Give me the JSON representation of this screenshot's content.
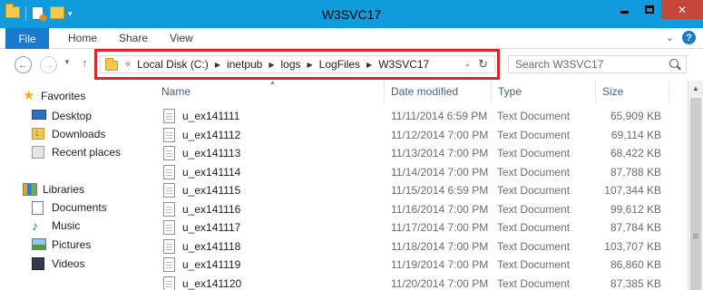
{
  "window": {
    "title": "W3SVC17",
    "accent": "#0f9bdc",
    "close_color": "#c7463a",
    "close_glyph": "✕",
    "qat_dropdown": "▾"
  },
  "ribbon": {
    "tabs": [
      {
        "label": "File"
      },
      {
        "label": "Home"
      },
      {
        "label": "Share"
      },
      {
        "label": "View"
      }
    ],
    "collapse_glyph": "⌄",
    "help_glyph": "?"
  },
  "navigation": {
    "back_glyph": "←",
    "forward_glyph": "→",
    "recent_glyph": "▼",
    "up_glyph": "↑",
    "address_prefix": "«",
    "breadcrumbs": [
      "Local Disk (C:)",
      "inetpub",
      "logs",
      "LogFiles",
      "W3SVC17"
    ],
    "crumb_separator": "▶",
    "dropdown_glyph": "⌄",
    "refresh_glyph": "↻",
    "highlight_color": "#d8262e"
  },
  "search": {
    "placeholder": "Search W3SVC17"
  },
  "nav_pane": {
    "favorites": {
      "label": "Favorites",
      "items": [
        "Desktop",
        "Downloads",
        "Recent places"
      ]
    },
    "libraries": {
      "label": "Libraries",
      "items": [
        "Documents",
        "Music",
        "Pictures",
        "Videos"
      ]
    }
  },
  "file_list": {
    "sort_glyph": "▲",
    "columns": [
      "Name",
      "Date modified",
      "Type",
      "Size"
    ],
    "rows": [
      {
        "name": "u_ex141111",
        "date": "11/11/2014 6:59 PM",
        "type": "Text Document",
        "size": "65,909 KB"
      },
      {
        "name": "u_ex141112",
        "date": "11/12/2014 7:00 PM",
        "type": "Text Document",
        "size": "69,114 KB"
      },
      {
        "name": "u_ex141113",
        "date": "11/13/2014 7:00 PM",
        "type": "Text Document",
        "size": "68,422 KB"
      },
      {
        "name": "u_ex141114",
        "date": "11/14/2014 7:00 PM",
        "type": "Text Document",
        "size": "87,788 KB"
      },
      {
        "name": "u_ex141115",
        "date": "11/15/2014 6:59 PM",
        "type": "Text Document",
        "size": "107,344 KB"
      },
      {
        "name": "u_ex141116",
        "date": "11/16/2014 7:00 PM",
        "type": "Text Document",
        "size": "99,612 KB"
      },
      {
        "name": "u_ex141117",
        "date": "11/17/2014 7:00 PM",
        "type": "Text Document",
        "size": "87,784 KB"
      },
      {
        "name": "u_ex141118",
        "date": "11/18/2014 7:00 PM",
        "type": "Text Document",
        "size": "103,707 KB"
      },
      {
        "name": "u_ex141119",
        "date": "11/19/2014 7:00 PM",
        "type": "Text Document",
        "size": "86,860 KB"
      },
      {
        "name": "u_ex141120",
        "date": "11/20/2014 7:00 PM",
        "type": "Text Document",
        "size": "87,385 KB"
      }
    ]
  },
  "scrollbar": {
    "up_glyph": "▲"
  }
}
